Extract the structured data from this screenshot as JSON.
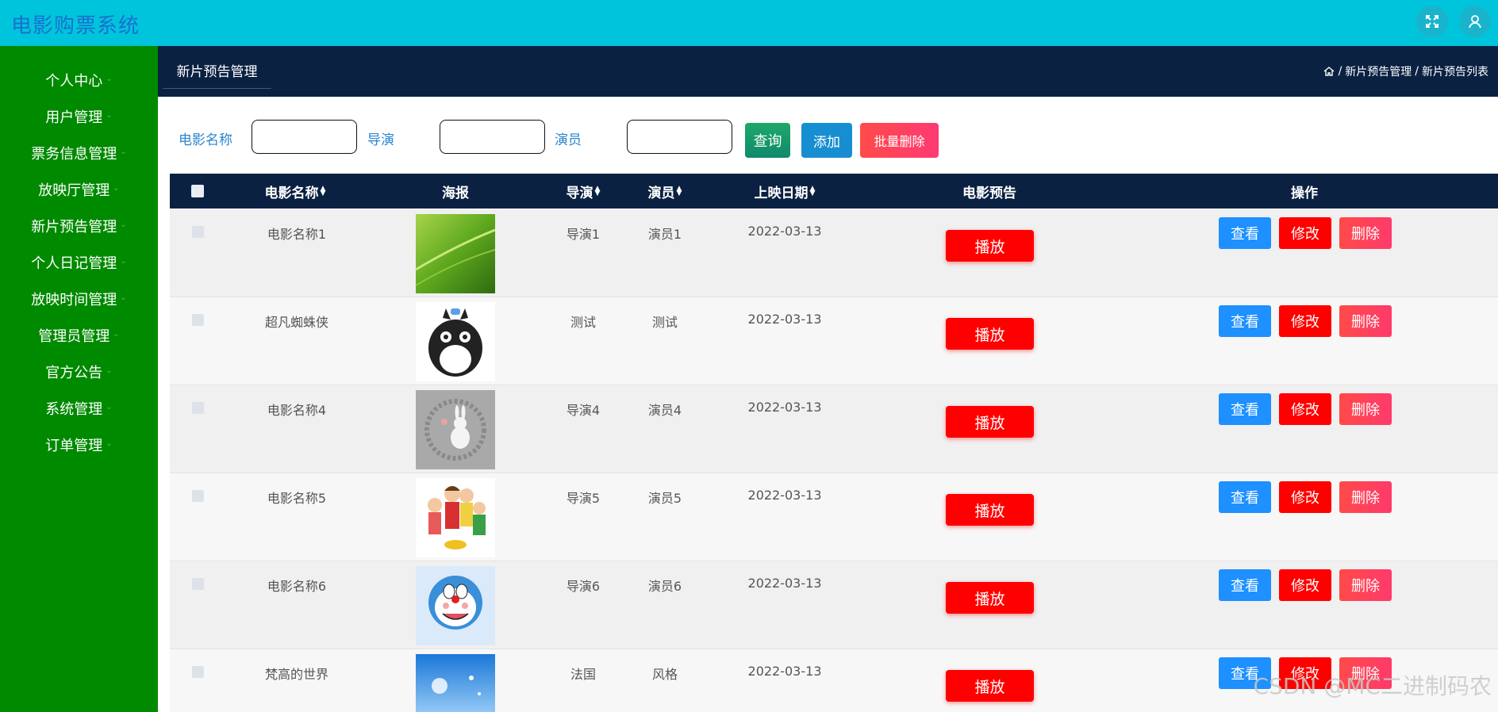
{
  "app": {
    "title": "电影购票系统"
  },
  "topbar": {
    "icons": [
      "fullscreen-icon",
      "user-icon"
    ]
  },
  "sidebar": {
    "items": [
      {
        "label": "个人中心"
      },
      {
        "label": "用户管理"
      },
      {
        "label": "票务信息管理"
      },
      {
        "label": "放映厅管理"
      },
      {
        "label": "新片预告管理"
      },
      {
        "label": "个人日记管理"
      },
      {
        "label": "放映时间管理"
      },
      {
        "label": "管理员管理"
      },
      {
        "label": "官方公告"
      },
      {
        "label": "系统管理"
      },
      {
        "label": "订单管理"
      }
    ]
  },
  "header": {
    "tab": "新片预告管理",
    "breadcrumb": {
      "sep1": "/",
      "item1": "新片预告管理",
      "sep2": "/",
      "item2": "新片预告列表"
    }
  },
  "search": {
    "name_label": "电影名称",
    "director_label": "导演",
    "actor_label": "演员",
    "name_value": "",
    "director_value": "",
    "actor_value": "",
    "query_button": "查询",
    "add_button": "添加",
    "bulk_delete_button": "批量删除"
  },
  "table": {
    "headers": {
      "name": "电影名称",
      "poster": "海报",
      "director": "导演",
      "actor": "演员",
      "date": "上映日期",
      "trailer": "电影预告",
      "ops": "操作"
    },
    "sortable": [
      "电影名称",
      "导演",
      "演员",
      "上映日期"
    ],
    "play_label": "播放",
    "view_label": "查看",
    "edit_label": "修改",
    "delete_label": "删除",
    "rows": [
      {
        "name": "电影名称1",
        "director": "导演1",
        "actor": "演员1",
        "date": "2022-03-13",
        "poster": "green-leaf"
      },
      {
        "name": "超凡蜘蛛侠",
        "director": "测试",
        "actor": "测试",
        "date": "2022-03-13",
        "poster": "totoro"
      },
      {
        "name": "电影名称4",
        "director": "导演4",
        "actor": "演员4",
        "date": "2022-03-13",
        "poster": "rabbit"
      },
      {
        "name": "电影名称5",
        "director": "导演5",
        "actor": "演员5",
        "date": "2022-03-13",
        "poster": "cartoon-kids"
      },
      {
        "name": "电影名称6",
        "director": "导演6",
        "actor": "演员6",
        "date": "2022-03-13",
        "poster": "doraemon"
      },
      {
        "name": "梵高的世界",
        "director": "法国",
        "actor": "风格",
        "date": "2022-03-13",
        "poster": "sky-dandelion"
      }
    ]
  },
  "watermark": "CSDN @MC二进制码农"
}
